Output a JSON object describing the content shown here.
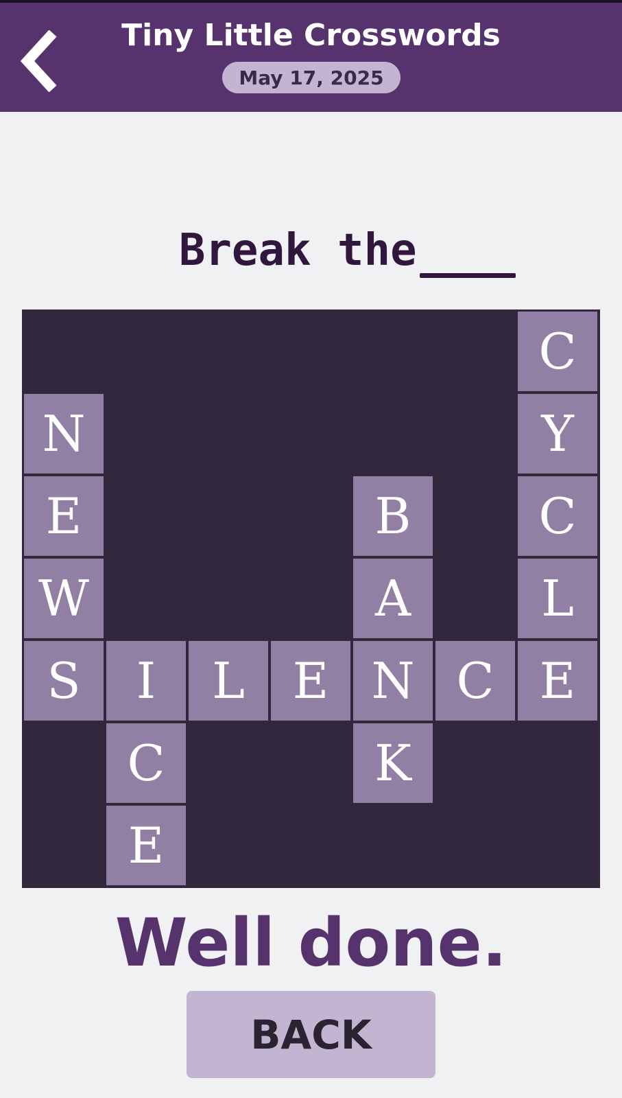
{
  "header": {
    "title": "Tiny Little Crosswords",
    "date": "May 17, 2025",
    "back_icon": "chevron-left-icon"
  },
  "puzzle": {
    "clue_text": "Break the ",
    "grid_size": 7,
    "cells": [
      {
        "row": 0,
        "col": 6,
        "letter": "C"
      },
      {
        "row": 1,
        "col": 0,
        "letter": "N"
      },
      {
        "row": 1,
        "col": 6,
        "letter": "Y"
      },
      {
        "row": 2,
        "col": 0,
        "letter": "E"
      },
      {
        "row": 2,
        "col": 4,
        "letter": "B"
      },
      {
        "row": 2,
        "col": 6,
        "letter": "C"
      },
      {
        "row": 3,
        "col": 0,
        "letter": "W"
      },
      {
        "row": 3,
        "col": 4,
        "letter": "A"
      },
      {
        "row": 3,
        "col": 6,
        "letter": "L"
      },
      {
        "row": 4,
        "col": 0,
        "letter": "S"
      },
      {
        "row": 4,
        "col": 1,
        "letter": "I"
      },
      {
        "row": 4,
        "col": 2,
        "letter": "L"
      },
      {
        "row": 4,
        "col": 3,
        "letter": "E"
      },
      {
        "row": 4,
        "col": 4,
        "letter": "N"
      },
      {
        "row": 4,
        "col": 5,
        "letter": "C"
      },
      {
        "row": 4,
        "col": 6,
        "letter": "E"
      },
      {
        "row": 5,
        "col": 1,
        "letter": "C"
      },
      {
        "row": 5,
        "col": 4,
        "letter": "K"
      },
      {
        "row": 6,
        "col": 1,
        "letter": "E"
      }
    ]
  },
  "result": {
    "message": "Well done.",
    "back_label": "BACK"
  },
  "colors": {
    "header_bg": "#56336c",
    "grid_bg": "#32283d",
    "cell_bg": "#9180a3",
    "pill_bg": "#c3b4d1",
    "accent_text": "#56336c"
  }
}
